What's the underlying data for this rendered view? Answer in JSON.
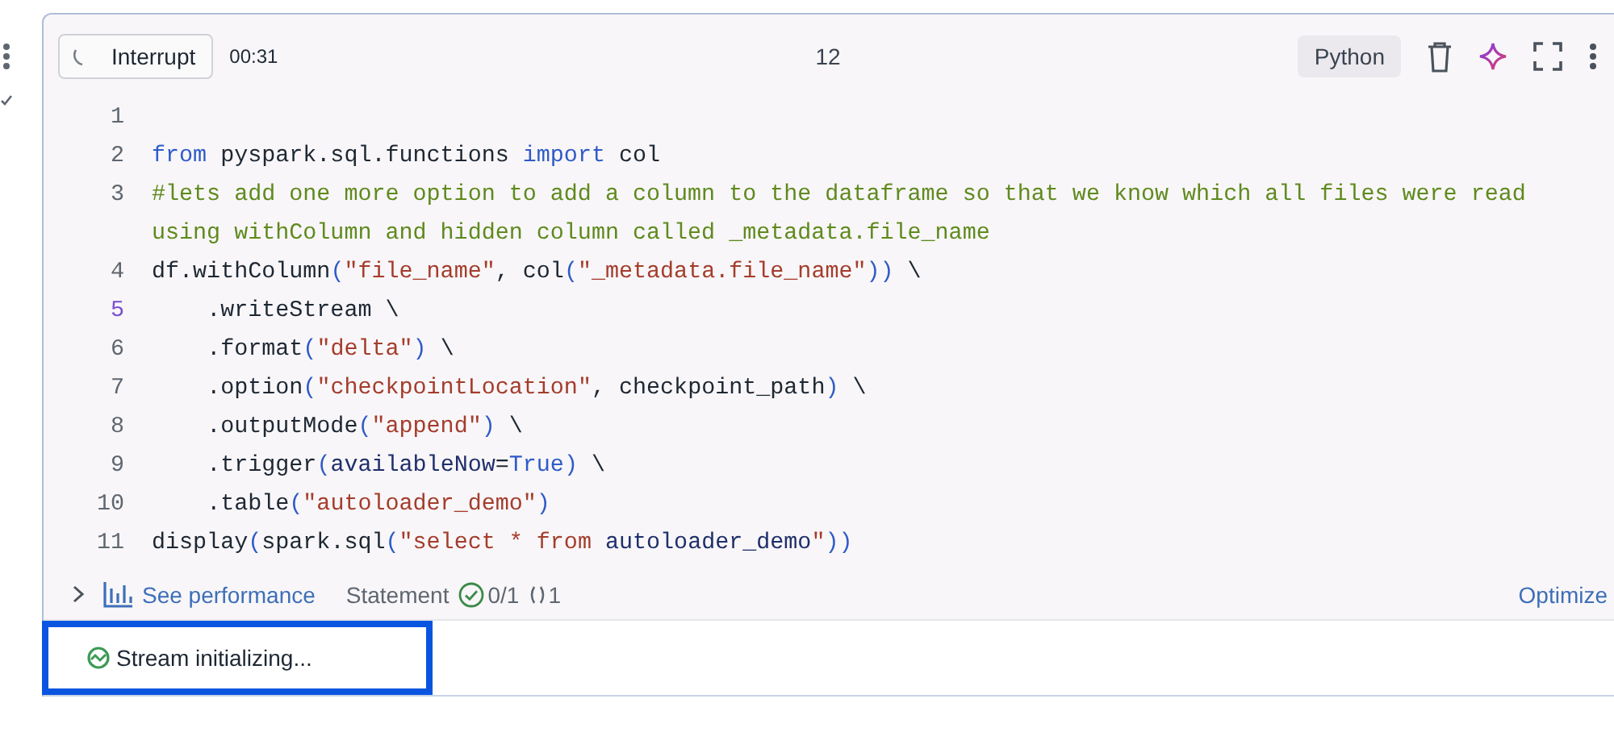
{
  "header": {
    "interrupt_button": "Interrupt",
    "elapsed": "00:31",
    "cell_number": "12",
    "language": "Python"
  },
  "code_lines": [
    {
      "number": "1",
      "current": false
    },
    {
      "number": "2",
      "current": false,
      "tokens": [
        {
          "kind": "keyword",
          "text": "from"
        },
        {
          "kind": "plain",
          "text": " pyspark.sql.functions "
        },
        {
          "kind": "keyword",
          "text": "import"
        },
        {
          "kind": "plain",
          "text": " col"
        }
      ]
    },
    {
      "number": "3",
      "current": false,
      "tokens": [
        {
          "kind": "comment",
          "text": "#lets add one more option to add a column to the dataframe so that we know which all files were read using withColumn and hidden column called _metadata.file_name"
        }
      ]
    },
    {
      "number": "4",
      "current": false,
      "tokens": [
        {
          "kind": "plain",
          "text": "df.withColumn"
        },
        {
          "kind": "bracket",
          "text": "("
        },
        {
          "kind": "string",
          "text": "\"file_name\""
        },
        {
          "kind": "plain",
          "text": ", col"
        },
        {
          "kind": "bracket",
          "text": "("
        },
        {
          "kind": "string",
          "text": "\"_metadata.file_name\""
        },
        {
          "kind": "bracket",
          "text": "))"
        },
        {
          "kind": "plain",
          "text": " \\"
        }
      ]
    },
    {
      "number": "5",
      "current": true,
      "tokens": [
        {
          "kind": "plain",
          "text": "    .writeStream \\"
        }
      ]
    },
    {
      "number": "6",
      "current": false,
      "tokens": [
        {
          "kind": "plain",
          "text": "    .format"
        },
        {
          "kind": "bracket",
          "text": "("
        },
        {
          "kind": "string",
          "text": "\"delta\""
        },
        {
          "kind": "bracket",
          "text": ")"
        },
        {
          "kind": "plain",
          "text": " \\"
        }
      ]
    },
    {
      "number": "7",
      "current": false,
      "tokens": [
        {
          "kind": "plain",
          "text": "    .option"
        },
        {
          "kind": "bracket",
          "text": "("
        },
        {
          "kind": "string",
          "text": "\"checkpointLocation\""
        },
        {
          "kind": "plain",
          "text": ", checkpoint_path"
        },
        {
          "kind": "bracket",
          "text": ")"
        },
        {
          "kind": "plain",
          "text": " \\"
        }
      ]
    },
    {
      "number": "8",
      "current": false,
      "tokens": [
        {
          "kind": "plain",
          "text": "    .outputMode"
        },
        {
          "kind": "bracket",
          "text": "("
        },
        {
          "kind": "string",
          "text": "\"append\""
        },
        {
          "kind": "bracket",
          "text": ")"
        },
        {
          "kind": "plain",
          "text": " \\"
        }
      ]
    },
    {
      "number": "9",
      "current": false,
      "tokens": [
        {
          "kind": "plain",
          "text": "    .trigger"
        },
        {
          "kind": "bracket",
          "text": "("
        },
        {
          "kind": "param",
          "text": "availableNow"
        },
        {
          "kind": "plain",
          "text": "="
        },
        {
          "kind": "keyword",
          "text": "True"
        },
        {
          "kind": "bracket",
          "text": ")"
        },
        {
          "kind": "plain",
          "text": " \\"
        }
      ]
    },
    {
      "number": "10",
      "current": false,
      "tokens": [
        {
          "kind": "plain",
          "text": "    .table"
        },
        {
          "kind": "bracket",
          "text": "("
        },
        {
          "kind": "string",
          "text": "\"autoloader_demo\""
        },
        {
          "kind": "bracket",
          "text": ")"
        }
      ]
    },
    {
      "number": "11",
      "current": false,
      "tokens": [
        {
          "kind": "plain",
          "text": "display"
        },
        {
          "kind": "bracket",
          "text": "("
        },
        {
          "kind": "plain",
          "text": "spark.sql"
        },
        {
          "kind": "bracket",
          "text": "("
        },
        {
          "kind": "string",
          "text": "\"select * from "
        },
        {
          "kind": "param",
          "text": "autoloader_demo"
        },
        {
          "kind": "string",
          "text": "\""
        },
        {
          "kind": "bracket",
          "text": "))"
        }
      ]
    }
  ],
  "footer": {
    "performance_link": "See performance",
    "statement_label": "Statement",
    "succeeded": "0/1",
    "running": "1",
    "optimize_link": "Optimize"
  },
  "output": {
    "status": "Stream initializing..."
  }
}
